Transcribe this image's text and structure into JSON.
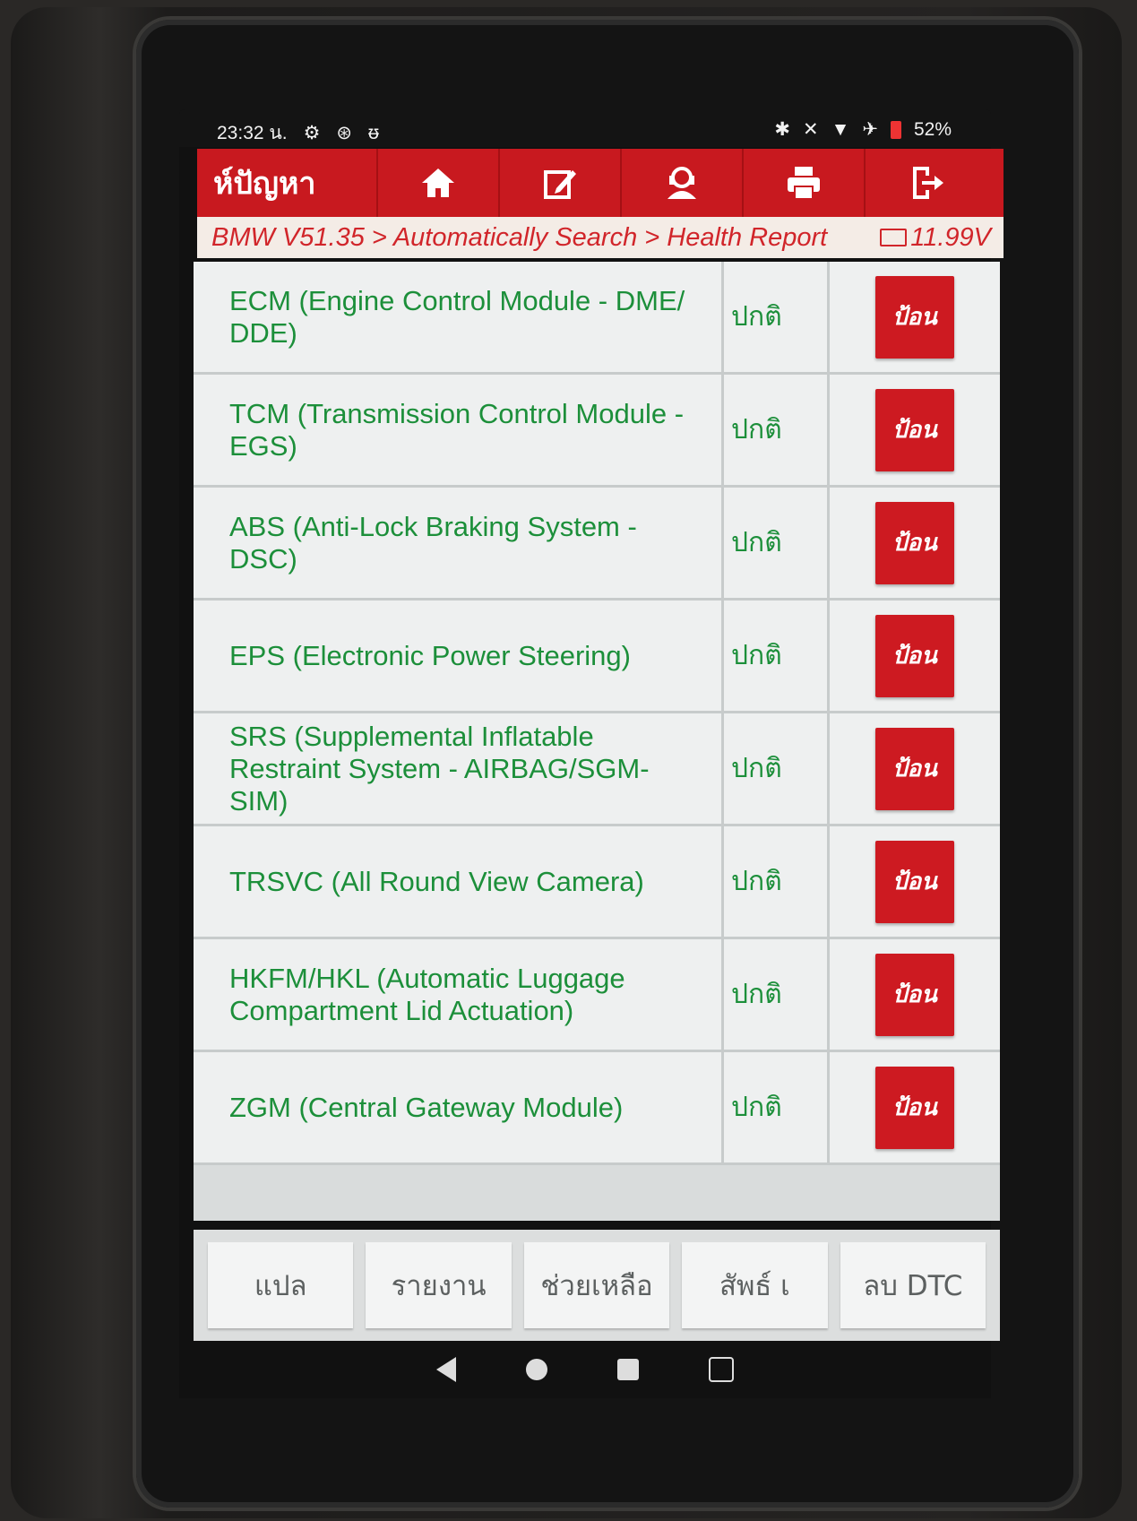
{
  "status_bar": {
    "time": "23:32 น.",
    "battery": "52%"
  },
  "toolbar": {
    "title": "ห์ปัญหา",
    "buttons": [
      {
        "icon": "home-icon"
      },
      {
        "icon": "edit-icon"
      },
      {
        "icon": "support-icon"
      },
      {
        "icon": "print-icon"
      },
      {
        "icon": "exit-icon"
      }
    ]
  },
  "breadcrumb": {
    "path": "BMW V51.35 > Automatically Search > Health Report",
    "voltage": "11.99V"
  },
  "modules": [
    {
      "name": "ECM (Engine Control Module - DME/ DDE)",
      "status": "ปกติ",
      "action": "ป้อน"
    },
    {
      "name": "TCM (Transmission Control Module - EGS)",
      "status": "ปกติ",
      "action": "ป้อน"
    },
    {
      "name": "ABS (Anti-Lock Braking System - DSC)",
      "status": "ปกติ",
      "action": "ป้อน"
    },
    {
      "name": "EPS (Electronic Power Steering)",
      "status": "ปกติ",
      "action": "ป้อน"
    },
    {
      "name": "SRS (Supplemental Inflatable Restraint System - AIRBAG/SGM-SIM)",
      "status": "ปกติ",
      "action": "ป้อน"
    },
    {
      "name": "TRSVC (All Round View Camera)",
      "status": "ปกติ",
      "action": "ป้อน"
    },
    {
      "name": "HKFM/HKL (Automatic Luggage Compartment Lid Actuation)",
      "status": "ปกติ",
      "action": "ป้อน"
    },
    {
      "name": "ZGM (Central Gateway Module)",
      "status": "ปกติ",
      "action": "ป้อน"
    }
  ],
  "bottom_buttons": {
    "translate": "แปล",
    "report": "รายงาน",
    "help": "ช่วยเหลือ",
    "related": "สัพธ์ เ",
    "clear_dtc": "ลบ DTC"
  },
  "colors": {
    "accent_red": "#cd1a21",
    "status_green": "#1c8f3a",
    "breadcrumb_red": "#d1252a"
  }
}
